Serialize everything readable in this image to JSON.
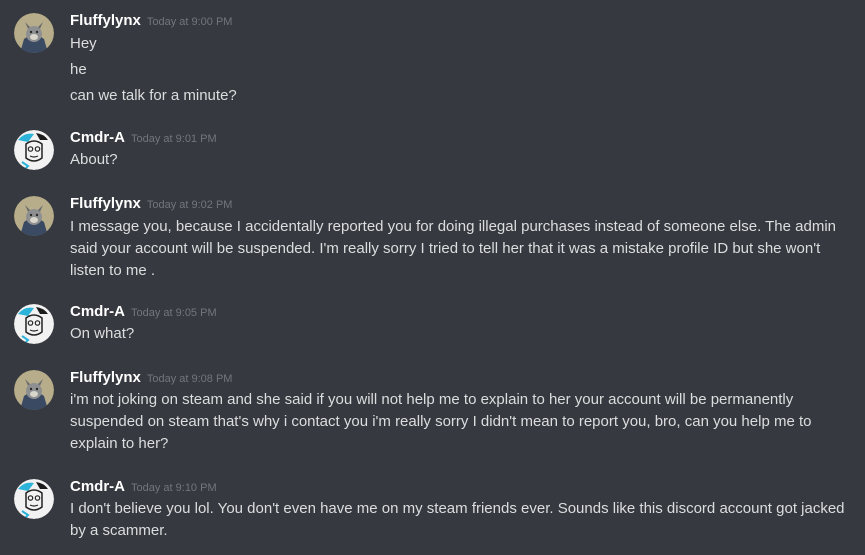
{
  "messages": [
    {
      "author": "Fluffylynx",
      "timestamp": "Today at 9:00 PM",
      "avatar": "lynx-avatar",
      "lines": [
        "Hey",
        "he",
        "can we talk for a minute?"
      ]
    },
    {
      "author": "Cmdr-A",
      "timestamp": "Today at 9:01 PM",
      "avatar": "cmdr-avatar",
      "lines": [
        "About?"
      ]
    },
    {
      "author": "Fluffylynx",
      "timestamp": "Today at 9:02 PM",
      "avatar": "lynx-avatar",
      "lines": [
        "I message you, because I accidentally reported you for doing illegal purchases instead of someone else. The admin",
        "said your account will be suspended. I'm really sorry I tried to tell her that it was a mistake profile ID but she won't",
        "listen to me ."
      ]
    },
    {
      "author": "Cmdr-A",
      "timestamp": "Today at 9:05 PM",
      "avatar": "cmdr-avatar",
      "lines": [
        "On what?"
      ]
    },
    {
      "author": "Fluffylynx",
      "timestamp": "Today at 9:08 PM",
      "avatar": "lynx-avatar",
      "lines": [
        "i'm not joking on steam and she said if you will not help me to explain to her your account will be permanently",
        "suspended on steam that's why i contact you i'm really sorry I didn't mean to report you, bro, can you help me to",
        "explain to her?"
      ]
    },
    {
      "author": "Cmdr-A",
      "timestamp": "Today at 9:10 PM",
      "avatar": "cmdr-avatar",
      "lines": [
        "I don't believe you lol. You don't even have me on my steam friends ever. Sounds like this discord account got jacked",
        "by a scammer."
      ]
    }
  ],
  "colors": {
    "background": "#36393f",
    "username": "#ffffff",
    "message_text": "#dcddde",
    "timestamp": "#72767d"
  }
}
